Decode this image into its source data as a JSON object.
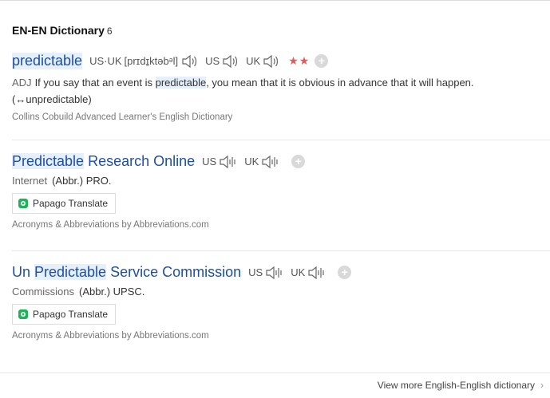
{
  "section": {
    "title": "EN-EN Dictionary",
    "count": "6"
  },
  "entries": [
    {
      "word": "predictable",
      "pron_label": "US·UK",
      "phonetic": "[prɪdɪ̱ktəbᵊl]",
      "us_label": "US",
      "uk_label": "UK",
      "stars": "★★",
      "pos": "ADJ",
      "def_before": "If you say that an event is ",
      "def_hl": "predictable",
      "def_after": ", you mean that it is obvious in advance that it will happen. (↔unpredictable)",
      "source": "Collins Cobuild Advanced Learner's English Dictionary"
    },
    {
      "word_hl": "Predictable",
      "word_rest": " Research Online",
      "us_label": "US",
      "uk_label": "UK",
      "category": "Internet",
      "abbr": "(Abbr.) PRO.",
      "translate_label": "Papago Translate",
      "source": "Acronyms & Abbreviations by Abbreviations.com"
    },
    {
      "word_pre": "Un ",
      "word_hl": "Predictable",
      "word_rest": " Service Commission",
      "us_label": "US",
      "uk_label": "UK",
      "category": "Commissions",
      "abbr": "(Abbr.) UPSC.",
      "translate_label": "Papago Translate",
      "source": "Acronyms & Abbreviations by Abbreviations.com"
    }
  ],
  "footer": {
    "view_more": "View more English-English dictionary"
  },
  "colors": {
    "link_blue": "#1e4fa3",
    "highlight": "#e6f0fb",
    "star_red": "#e45a5a",
    "papago_green": "#1db35a"
  }
}
